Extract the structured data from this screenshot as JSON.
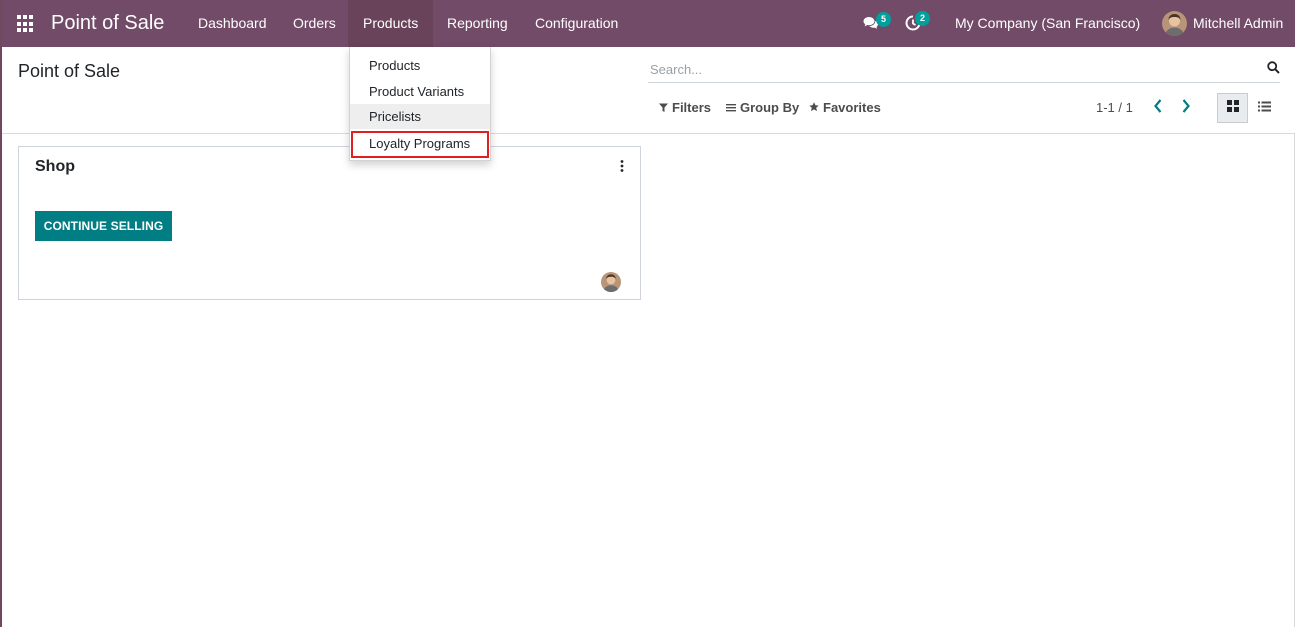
{
  "navbar": {
    "brand": "Point of Sale",
    "menu": [
      {
        "label": "Dashboard"
      },
      {
        "label": "Orders"
      },
      {
        "label": "Products"
      },
      {
        "label": "Reporting"
      },
      {
        "label": "Configuration"
      }
    ],
    "messages_count": "5",
    "activities_count": "2",
    "company": "My Company (San Francisco)",
    "user": "Mitchell Admin"
  },
  "products_dropdown": {
    "items": [
      {
        "label": "Products"
      },
      {
        "label": "Product Variants"
      },
      {
        "label": "Pricelists"
      },
      {
        "label": "Loyalty Programs"
      }
    ]
  },
  "control_panel": {
    "title": "Point of Sale",
    "search_placeholder": "Search...",
    "filters_label": "Filters",
    "group_by_label": "Group By",
    "favorites_label": "Favorites",
    "pager": "1-1 / 1"
  },
  "kanban": {
    "card": {
      "title": "Shop",
      "button_label": "CONTINUE SELLING"
    }
  },
  "colors": {
    "navbar": "#714b67",
    "primary_button": "#017e84",
    "badge": "#00a09d",
    "highlight_border": "#e02020"
  }
}
